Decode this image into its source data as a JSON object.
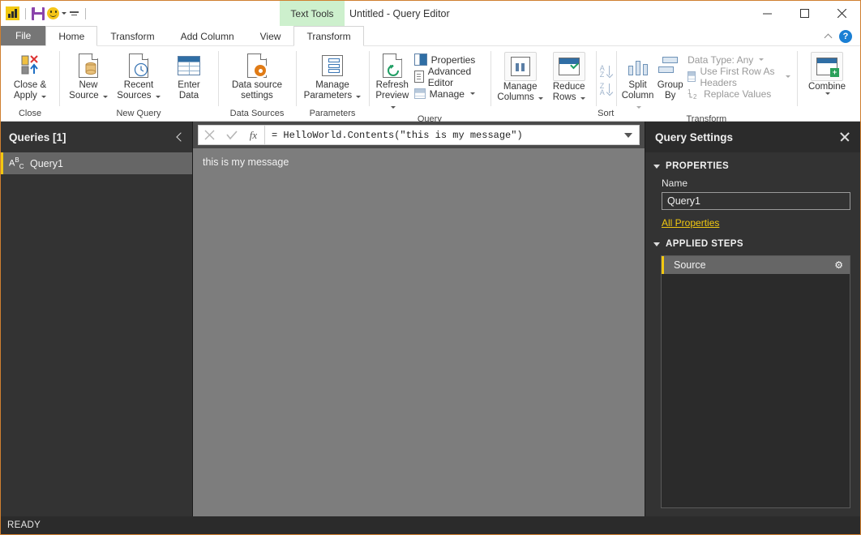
{
  "titlebar": {
    "window_title": "Untitled - Query Editor",
    "contextual_tab_group": "Text Tools",
    "qat": [
      {
        "name": "powerbi-logo",
        "label": "Power BI"
      },
      {
        "name": "save",
        "label": "Save"
      },
      {
        "name": "smiley",
        "label": "Send a Smile"
      },
      {
        "name": "customize",
        "label": "Customize Quick Access Toolbar"
      }
    ],
    "window_controls": {
      "minimize": "—",
      "maximize": "□",
      "close": "✕"
    }
  },
  "tabs": [
    {
      "label": "File",
      "kind": "file"
    },
    {
      "label": "Home",
      "kind": "active"
    },
    {
      "label": "Transform",
      "kind": "normal"
    },
    {
      "label": "Add Column",
      "kind": "normal"
    },
    {
      "label": "View",
      "kind": "normal"
    },
    {
      "label": "Transform",
      "kind": "contextual"
    }
  ],
  "tabstrip_right": {
    "collapse_ribbon": "collapse-ribbon",
    "help": "?"
  },
  "ribbon": {
    "groups": [
      {
        "label": "Close",
        "buttons": [
          {
            "label": "Close &\nApply",
            "icon": "close-apply-icon",
            "dropdown": true
          }
        ]
      },
      {
        "label": "New Query",
        "buttons": [
          {
            "label": "New\nSource",
            "icon": "new-source-icon",
            "dropdown": true
          },
          {
            "label": "Recent\nSources",
            "icon": "recent-sources-icon",
            "dropdown": true
          },
          {
            "label": "Enter\nData",
            "icon": "enter-data-icon",
            "dropdown": false
          }
        ]
      },
      {
        "label": "Data Sources",
        "buttons": [
          {
            "label": "Data source\nsettings",
            "icon": "data-source-settings-icon",
            "dropdown": false
          }
        ]
      },
      {
        "label": "Parameters",
        "buttons": [
          {
            "label": "Manage\nParameters",
            "icon": "manage-parameters-icon",
            "dropdown": true
          }
        ]
      },
      {
        "label": "Query",
        "buttons": [
          {
            "label": "Refresh\nPreview",
            "icon": "refresh-preview-icon",
            "dropdown": true
          }
        ],
        "small_items": [
          {
            "label": "Properties",
            "icon": "properties-icon",
            "dropdown": false
          },
          {
            "label": "Advanced Editor",
            "icon": "advanced-editor-icon",
            "dropdown": false
          },
          {
            "label": "Manage",
            "icon": "manage-icon",
            "dropdown": true
          }
        ]
      },
      {
        "label": "",
        "buttons": [
          {
            "label": "Manage\nColumns",
            "icon": "manage-columns-icon",
            "dropdown": true
          },
          {
            "label": "Reduce\nRows",
            "icon": "reduce-rows-icon",
            "dropdown": true
          }
        ]
      },
      {
        "label": "Sort",
        "small_items": [
          {
            "label": "sort-ascending",
            "icon": "sort-az-icon",
            "disabled": true
          },
          {
            "label": "sort-descending",
            "icon": "sort-za-icon",
            "disabled": true
          }
        ]
      },
      {
        "label": "Transform",
        "buttons": [
          {
            "label": "Split\nColumn",
            "icon": "split-column-icon",
            "dropdown": true
          },
          {
            "label": "Group\nBy",
            "icon": "group-by-icon",
            "dropdown": false
          }
        ],
        "small_items": [
          {
            "label": "Data Type: Any",
            "icon": "data-type-icon",
            "dropdown": true
          },
          {
            "label": "Use First Row As Headers",
            "icon": "first-row-headers-icon",
            "dropdown": true
          },
          {
            "label": "Replace Values",
            "icon": "replace-values-icon",
            "dropdown": false
          }
        ]
      },
      {
        "label": "",
        "buttons": [
          {
            "label": "Combine",
            "icon": "combine-icon",
            "dropdown": true
          }
        ]
      }
    ]
  },
  "queries_panel": {
    "title": "Queries [1]",
    "collapse": "collapse-queries",
    "items": [
      {
        "name": "Query1",
        "icon": "abc-text-icon",
        "selected": true
      }
    ]
  },
  "formula_bar": {
    "cancel": "✕",
    "accept": "✓",
    "fx": "fx",
    "value": "= HelloWorld.Contents(\"this is my message\")",
    "expand": "expand-formula-bar"
  },
  "preview": {
    "value": "this is my message"
  },
  "query_settings": {
    "title": "Query Settings",
    "close": "close-query-settings",
    "properties": {
      "section_label": "PROPERTIES",
      "name_label": "Name",
      "name_value": "Query1",
      "all_properties_link": "All Properties"
    },
    "applied_steps": {
      "section_label": "APPLIED STEPS",
      "steps": [
        {
          "label": "Source",
          "selected": true,
          "gear": "⚙"
        }
      ]
    }
  },
  "statusbar": {
    "text": "READY"
  },
  "colors": {
    "accent_yellow": "#f2c811",
    "contextual_green": "#cdf0cd",
    "panel_dark": "#333333",
    "preview_gray": "#7d7d7d",
    "window_border": "#d08030"
  }
}
